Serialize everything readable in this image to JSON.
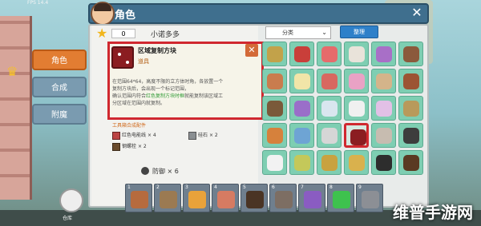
{
  "fps": "FPS 14.4",
  "title": "角色",
  "coins": "0",
  "player_name": "小诺多多",
  "tabs": [
    "角色",
    "合成",
    "附魔"
  ],
  "category": "分类",
  "sort_button": "整理",
  "tooltip": {
    "name": "区域复制方块",
    "type": "道具",
    "desc_1": "在范围64*64，高度不限的立方体时角，各放置一个",
    "desc_2": "复制方块后，会出现一个标记范围，",
    "desc_3": "确认范围内符合",
    "desc_green": "红色复制方块时框",
    "desc_4": "就能复制该区域工",
    "desc_5": "分区域在范围内就复制。"
  },
  "materials_title": "工具箱合成配件",
  "materials": [
    {
      "name": "红色电能线",
      "qty": "× 4"
    },
    {
      "name": "硅石",
      "qty": "× 2"
    },
    {
      "name": "钢螺栓",
      "qty": "× 2"
    }
  ],
  "quantity_label": "防御",
  "quantity_value": "× 6",
  "warehouse_label": "仓库",
  "hotbar_numbers": [
    "1",
    "2",
    "3",
    "4",
    "5",
    "6",
    "7",
    "8",
    "9"
  ],
  "watermark": "维普手游网"
}
